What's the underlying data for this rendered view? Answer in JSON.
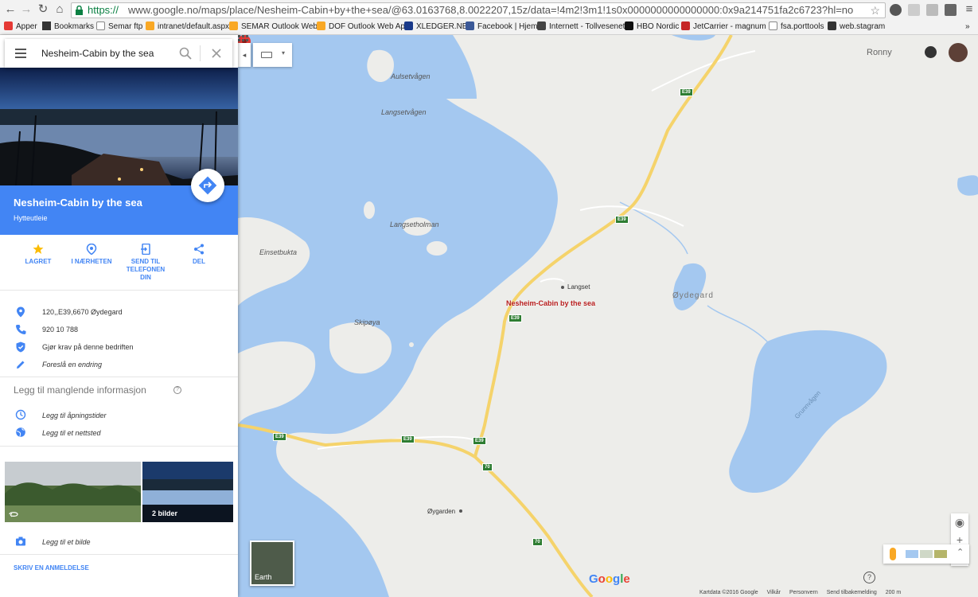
{
  "browser": {
    "url_scheme": "https://",
    "url_rest": "www.google.no/maps/place/Nesheim-Cabin+by+the+sea/@63.0163768,8.0022207,15z/data=!4m2!3m1!1s0x0000000000000000:0x9a214751fa2c6723?hl=no",
    "bookmarks": [
      "Apper",
      "Bookmarks",
      "Semar ftp",
      "intranet/default.aspx",
      "SEMAR Outlook Web",
      "DOF Outlook Web Ap",
      "XLEDGER.NET",
      "Facebook | Hjem",
      "Internett - Tollvesenet",
      "HBO Nordic",
      "JetCarrier - magnum",
      "fsa.porttools",
      "web.stagram"
    ]
  },
  "search": {
    "query": "Nesheim-Cabin by the sea"
  },
  "place": {
    "name": "Nesheim-Cabin by the sea",
    "category": "Hytteutleie",
    "directions_label": "Veibeskrivelse"
  },
  "actions": {
    "saved": "LAGRET",
    "nearby": "I NÆRHETEN",
    "send_line1": "SEND TIL",
    "send_line2": "TELEFONEN",
    "send_line3": "DIN",
    "share": "DEL"
  },
  "info": {
    "address": "120,,E39,6670 Øydegard",
    "phone": "920 10 788",
    "claim": "Gjør krav på denne bedriften",
    "suggest": "Foreslå en endring"
  },
  "missing": {
    "title": "Legg til manglende informasjon",
    "hours": "Legg til åpningstider",
    "website": "Legg til et nettsted"
  },
  "photos": {
    "count_label": "2 bilder",
    "add_photo": "Legg til et bilde"
  },
  "review": {
    "label": "SKRIV EN ANMELDELSE"
  },
  "map": {
    "user": "Ronny",
    "earth_label": "Earth",
    "google_logo": "Google",
    "labels": {
      "aulsetvagen": "Aulsetvågen",
      "langsetvagen": "Langsetvågen",
      "langsetholman": "Langsetholman",
      "einsetbukta": "Einsetbukta",
      "skipoya": "Skipøya",
      "langset": "Langset",
      "oydegard": "Øydegard",
      "oygarden": "Øygarden",
      "grunnvagen": "Grunnvågen",
      "pin": "Nesheim-Cabin by the sea"
    },
    "road_e39": "E39",
    "road_70": "70",
    "footer": [
      "Kartdata ©2016 Google",
      "Vilkår",
      "Personvern",
      "Send tilbakemelding",
      "200 m"
    ],
    "colors": {
      "water": "#a4c8f0",
      "land": "#ededea",
      "road": "#f5d36b",
      "panel_blue": "#4285f4"
    }
  }
}
